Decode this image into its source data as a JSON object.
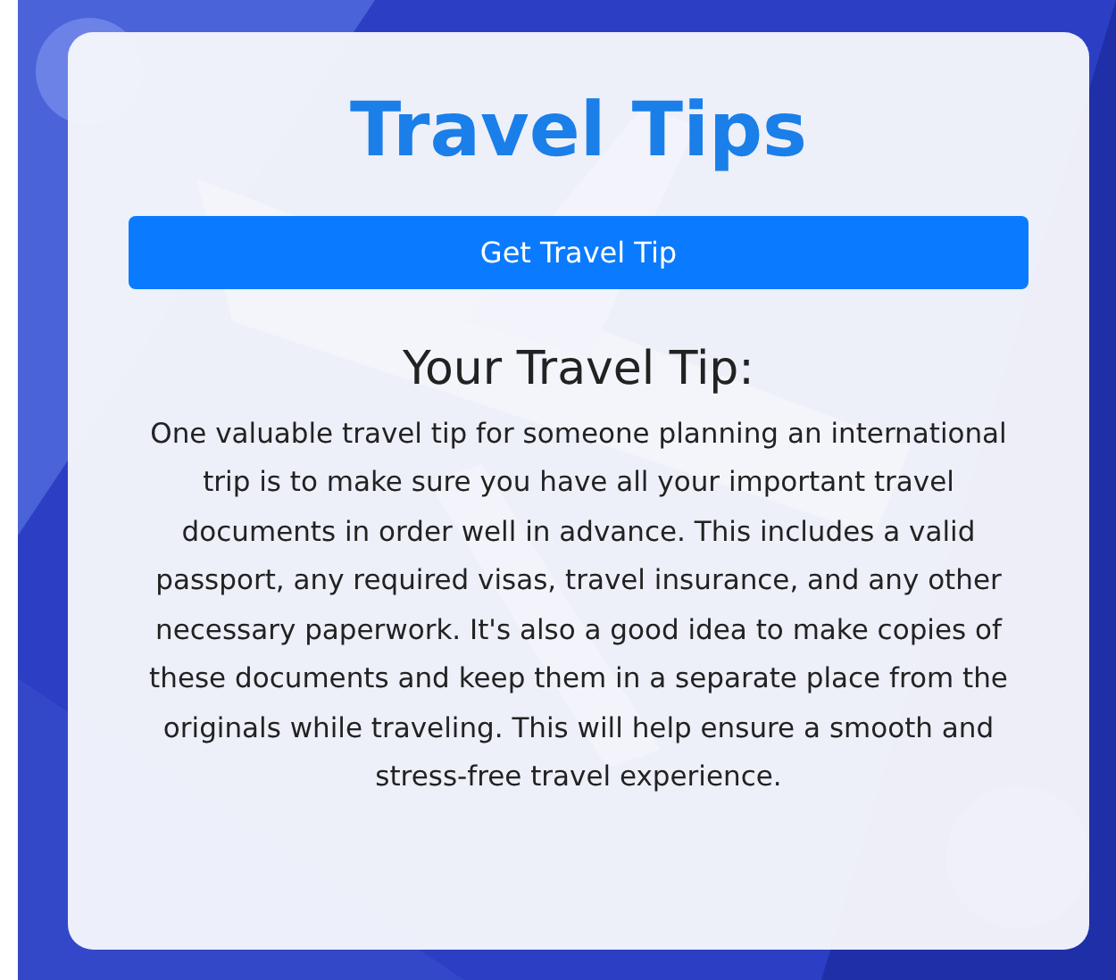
{
  "title": "Travel Tips",
  "button": {
    "label": "Get Travel Tip"
  },
  "tip": {
    "heading": "Your Travel Tip:",
    "text": "One valuable travel tip for someone planning an international trip is to make sure you have all your important travel documents in order well in advance. This includes a valid passport, any required visas, travel insurance, and any other necessary paperwork. It's also a good idea to make copies of these documents and keep them in a separate place from the originals while traveling. This will help ensure a smooth and stress-free travel experience."
  }
}
